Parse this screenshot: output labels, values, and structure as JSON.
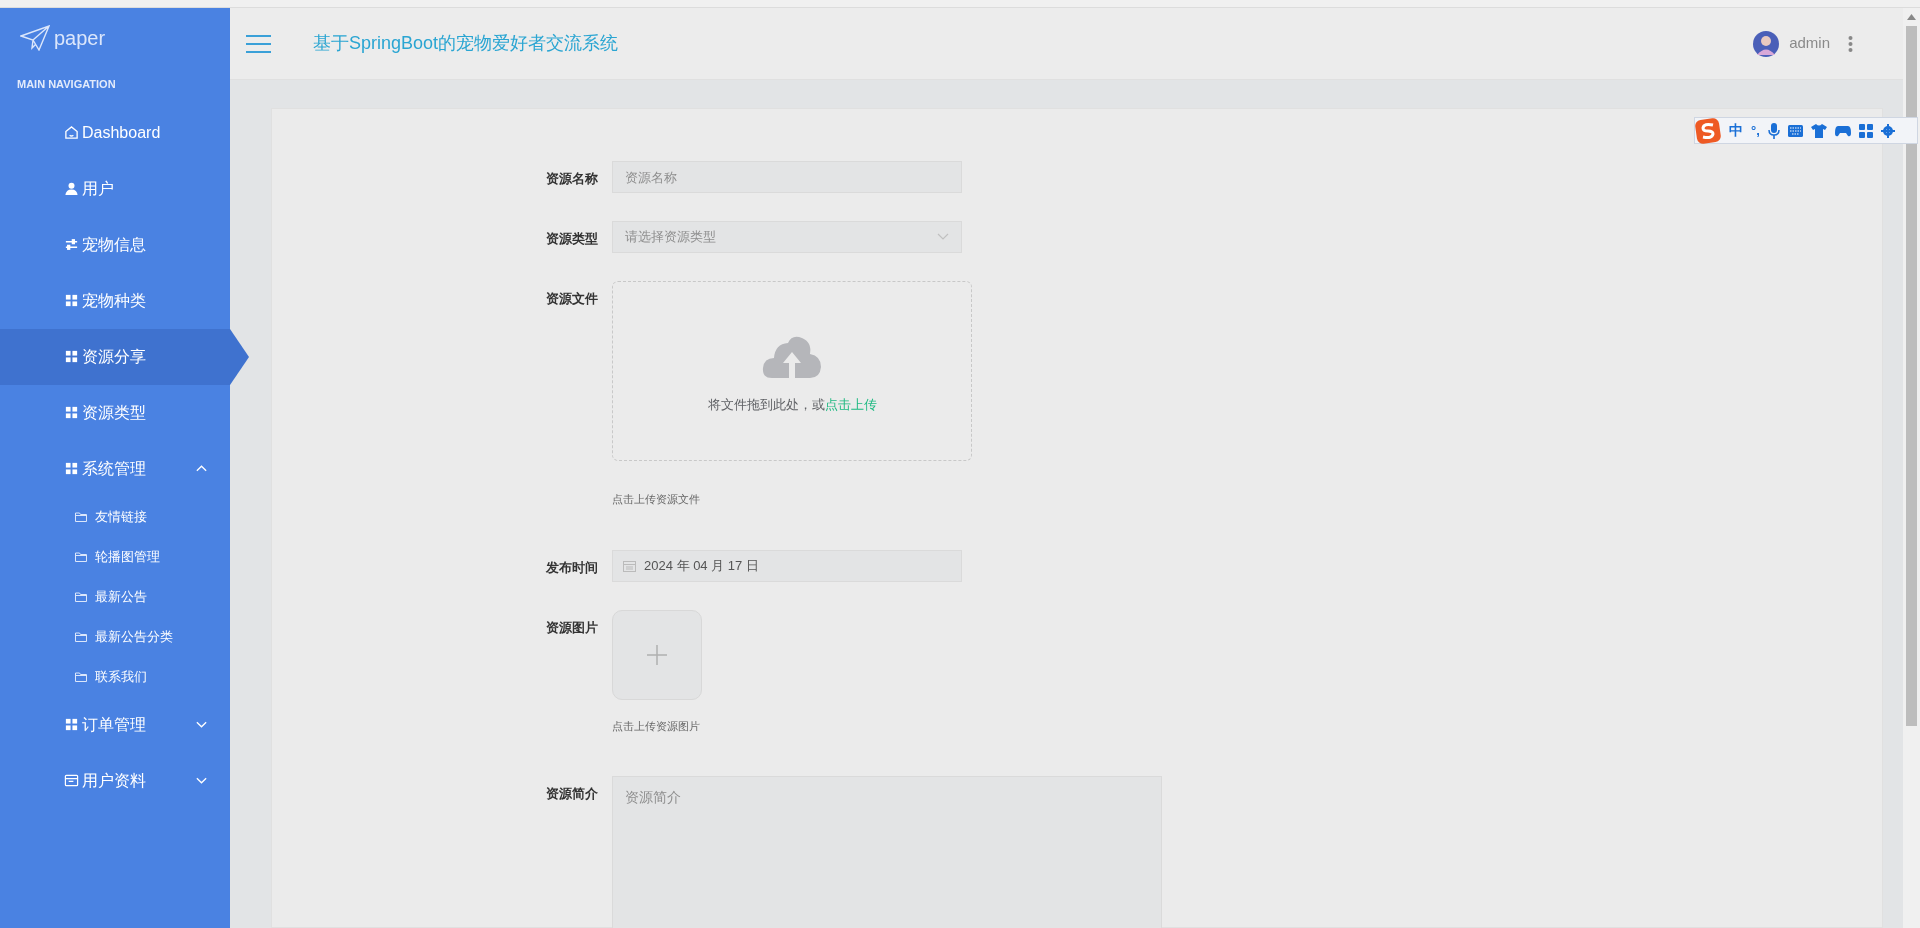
{
  "sidebar": {
    "logo": "paper",
    "heading": "MAIN NAVIGATION",
    "items": [
      {
        "label": "Dashboard",
        "kind": "home",
        "selected": false
      },
      {
        "label": "用户",
        "kind": "user",
        "selected": false
      },
      {
        "label": "宠物信息",
        "kind": "sliders",
        "selected": false
      },
      {
        "label": "宠物种类",
        "kind": "grid",
        "selected": false
      },
      {
        "label": "资源分享",
        "kind": "grid",
        "selected": true
      },
      {
        "label": "资源类型",
        "kind": "grid",
        "selected": false
      },
      {
        "label": "系统管理",
        "kind": "grid",
        "selected": false,
        "expanded": true,
        "children": [
          {
            "label": "友情链接",
            "selected": false
          },
          {
            "label": "轮播图管理",
            "selected": false
          },
          {
            "label": "最新公告",
            "selected": false
          },
          {
            "label": "最新公告分类",
            "selected": false
          },
          {
            "label": "联系我们",
            "selected": false
          }
        ]
      },
      {
        "label": "订单管理",
        "kind": "grid",
        "selected": false,
        "expanded": false
      },
      {
        "label": "用户资料",
        "kind": "card",
        "selected": false,
        "expanded": false
      }
    ]
  },
  "header": {
    "title": "基于SpringBoot的宠物爱好者交流系统",
    "user": "admin"
  },
  "ime_toolbar": {
    "mode": "中",
    "punctuation": "°,"
  },
  "form": {
    "fields": [
      {
        "kind": "text",
        "label": "资源名称",
        "placeholder": "资源名称"
      },
      {
        "kind": "select",
        "label": "资源类型",
        "placeholder": "请选择资源类型"
      },
      {
        "kind": "file",
        "label": "资源文件",
        "drop_text": "将文件拖到此处，或",
        "link": "点击上传",
        "hint": "点击上传资源文件"
      },
      {
        "kind": "date",
        "label": "发布时间",
        "value": "2024 年 04 月 17 日"
      },
      {
        "kind": "image",
        "label": "资源图片",
        "hint": "点击上传资源图片"
      },
      {
        "kind": "textarea",
        "label": "资源简介",
        "placeholder": "资源简介"
      }
    ]
  }
}
